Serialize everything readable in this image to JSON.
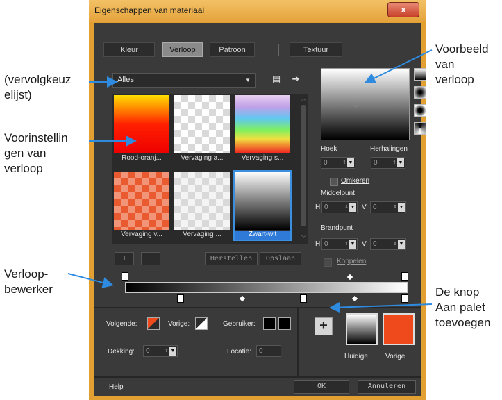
{
  "window": {
    "title": "Eigenschappen van materiaal",
    "close_label": "x"
  },
  "tabs": [
    {
      "label": "Kleur",
      "active": false
    },
    {
      "label": "Verloop",
      "active": true
    },
    {
      "label": "Patroon",
      "active": false
    },
    {
      "label": "Textuur",
      "active": false
    }
  ],
  "category_dropdown": {
    "value": "Alles"
  },
  "presets": [
    {
      "label": "Rood-oranj...",
      "style": "red-orange"
    },
    {
      "label": "Vervaging a...",
      "style": "fade-white"
    },
    {
      "label": "Vervaging s...",
      "style": "fade-spectrum"
    },
    {
      "label": "Vervaging v...",
      "style": "fade-red"
    },
    {
      "label": "Vervaging ...",
      "style": "fade-gray"
    },
    {
      "label": "Zwart-wit",
      "style": "black-white",
      "selected": true
    }
  ],
  "preset_actions": {
    "add": "+",
    "remove": "−",
    "reset": "Herstellen",
    "save": "Opslaan"
  },
  "preview_panel": {
    "hoek_label": "Hoek",
    "hoek_value": "0",
    "herhalingen_label": "Herhalingen",
    "herhalingen_value": "0",
    "omkeren_label": "Omkeren",
    "middelpunt_label": "Middelpunt",
    "middelpunt_h": "0",
    "middelpunt_v": "0",
    "brandpunt_label": "Brandpunt",
    "brandpunt_h": "0",
    "brandpunt_v": "0",
    "h_label": "H",
    "v_label": "V",
    "koppelen_label": "Koppelen"
  },
  "editor": {
    "volgende_label": "Volgende:",
    "vorige_label": "Vorige:",
    "gebruiker_label": "Gebruiker:",
    "dekking_label": "Dekking:",
    "dekking_value": "0",
    "locatie_label": "Locatie:",
    "locatie_value": "0"
  },
  "swatches": {
    "add_button": "+",
    "huidige_label": "Huidige",
    "vorige_label": "Vorige",
    "vorige_color": "#ee4a1c"
  },
  "footer": {
    "help": "Help",
    "ok": "OK",
    "cancel": "Annuleren"
  },
  "annotations": {
    "dropdown": [
      "(vervolgkeuz",
      "elijst)"
    ],
    "presets": [
      "Voorinstellin",
      "gen van",
      "verloop"
    ],
    "editor": [
      "Verloop-",
      "bewerker"
    ],
    "preview": [
      "Voorbeeld",
      "van",
      "verloop"
    ],
    "palette": [
      "De knop",
      "Aan palet",
      "toevoegen"
    ]
  },
  "colors": {
    "accent_blue": "#2e8be0",
    "dialog_bg": "#3a3a3a",
    "title_bar": "#e5a23a"
  }
}
